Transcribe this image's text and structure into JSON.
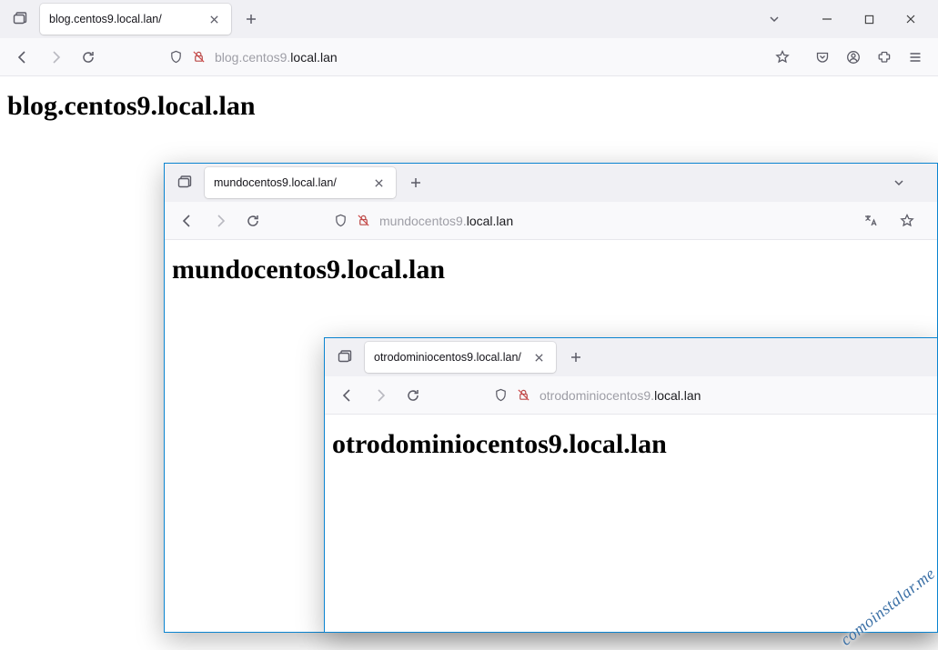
{
  "windows": [
    {
      "tab_title": "blog.centos9.local.lan/",
      "url_faded": "blog.centos9.",
      "url_strong": "local.lan",
      "heading": "blog.centos9.local.lan",
      "has_window_controls": true,
      "has_pocket": true,
      "has_account": true,
      "has_extensions": true,
      "has_menu": true,
      "has_translate": false
    },
    {
      "tab_title": "mundocentos9.local.lan/",
      "url_faded": "mundocentos9.",
      "url_strong": "local.lan",
      "heading": "mundocentos9.local.lan",
      "has_window_controls": false,
      "has_pocket": false,
      "has_account": false,
      "has_extensions": false,
      "has_menu": false,
      "has_translate": true
    },
    {
      "tab_title": "otrodominiocentos9.local.lan/",
      "url_faded": "otrodominiocentos9.",
      "url_strong": "local.lan",
      "heading": "otrodominiocentos9.local.lan",
      "has_window_controls": false,
      "has_pocket": false,
      "has_account": false,
      "has_extensions": false,
      "has_menu": false,
      "has_translate": false
    }
  ],
  "watermark": "comoinstalar.me"
}
